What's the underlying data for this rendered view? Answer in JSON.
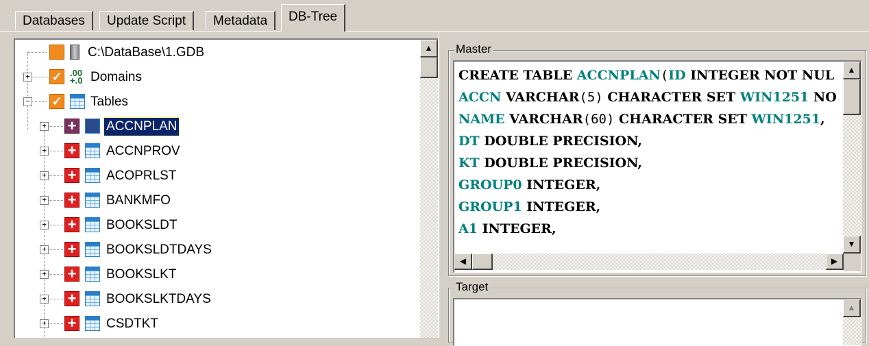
{
  "tabs": [
    "Databases",
    "Update Script",
    "Metadata",
    "DB-Tree"
  ],
  "active_tab": "DB-Tree",
  "tree": {
    "root": {
      "label": "C:\\DataBase\\1.GDB",
      "icon": "database-icon"
    },
    "nodes": [
      {
        "label": "Domains",
        "icon": "domains-icon",
        "expander": "+"
      },
      {
        "label": "Tables",
        "icon": "tables-icon",
        "expander": "−"
      }
    ],
    "tables": [
      {
        "label": "ACCNPLAN",
        "selected": true
      },
      {
        "label": "ACCNPROV"
      },
      {
        "label": "ACOPRLST"
      },
      {
        "label": "BANKMFO"
      },
      {
        "label": "BOOKSLDT"
      },
      {
        "label": "BOOKSLDTDAYS"
      },
      {
        "label": "BOOKSLKT"
      },
      {
        "label": "BOOKSLKTDAYS"
      },
      {
        "label": "CSDTKT"
      }
    ],
    "expander_plus": "+"
  },
  "master": {
    "title": "Master",
    "lines": [
      [
        {
          "t": "CREATE TABLE ",
          "c": "kw"
        },
        {
          "t": "ACCNPLAN",
          "c": "id"
        },
        {
          "t": "(",
          "c": "nm"
        },
        {
          "t": "ID",
          "c": "id"
        },
        {
          "t": " INTEGER NOT NUL",
          "c": "kw"
        }
      ],
      [
        {
          "t": "ACCN",
          "c": "id"
        },
        {
          "t": " VARCHAR",
          "c": "kw"
        },
        {
          "t": "(5)",
          "c": "nm"
        },
        {
          "t": " CHARACTER SET ",
          "c": "kw"
        },
        {
          "t": "WIN1251",
          "c": "id"
        },
        {
          "t": " NO",
          "c": "kw"
        }
      ],
      [
        {
          "t": "NAME",
          "c": "id"
        },
        {
          "t": " VARCHAR",
          "c": "kw"
        },
        {
          "t": "(60)",
          "c": "nm"
        },
        {
          "t": " CHARACTER SET ",
          "c": "kw"
        },
        {
          "t": "WIN1251",
          "c": "id"
        },
        {
          "t": ",",
          "c": "kw"
        }
      ],
      [
        {
          "t": "DT",
          "c": "id"
        },
        {
          "t": " DOUBLE PRECISION,",
          "c": "kw"
        }
      ],
      [
        {
          "t": "KT",
          "c": "id"
        },
        {
          "t": " DOUBLE PRECISION,",
          "c": "kw"
        }
      ],
      [
        {
          "t": "GROUP0",
          "c": "id"
        },
        {
          "t": " INTEGER,",
          "c": "kw"
        }
      ],
      [
        {
          "t": "GROUP1",
          "c": "id"
        },
        {
          "t": " INTEGER,",
          "c": "kw"
        }
      ],
      [
        {
          "t": "A1",
          "c": "id"
        },
        {
          "t": " INTEGER,",
          "c": "kw"
        }
      ]
    ]
  },
  "target": {
    "title": "Target"
  },
  "scroll_arrows": {
    "up": "▲",
    "down": "▼",
    "left": "◀",
    "right": "▶"
  }
}
